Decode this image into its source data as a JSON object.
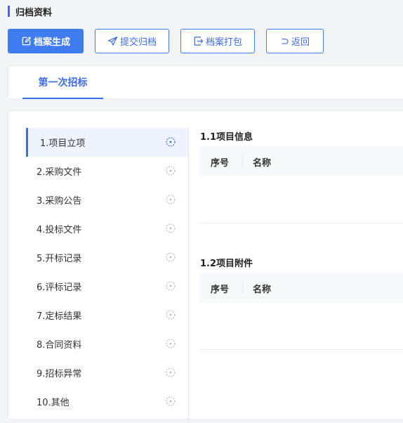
{
  "page": {
    "title": "归档资料"
  },
  "toolbar": {
    "generate_label": "档案生成",
    "submit_label": "提交归档",
    "pack_label": "档案打包",
    "back_label": "返回"
  },
  "tabs": [
    {
      "label": "第一次招标",
      "active": true
    }
  ],
  "nav": {
    "items": [
      {
        "label": "1.项目立项",
        "active": true
      },
      {
        "label": "2.采购文件",
        "active": false
      },
      {
        "label": "3.采购公告",
        "active": false
      },
      {
        "label": "4.投标文件",
        "active": false
      },
      {
        "label": "5.开标记录",
        "active": false
      },
      {
        "label": "6.评标记录",
        "active": false
      },
      {
        "label": "7.定标结果",
        "active": false
      },
      {
        "label": "8.合同资料",
        "active": false
      },
      {
        "label": "9.招标异常",
        "active": false
      },
      {
        "label": "10.其他",
        "active": false
      }
    ],
    "status_icon": "dashed-circle-icon"
  },
  "sections": [
    {
      "title": "1.1项目信息",
      "columns": [
        "序号",
        "名称"
      ],
      "rows": []
    },
    {
      "title": "1.2项目附件",
      "columns": [
        "序号",
        "名称"
      ],
      "rows": []
    }
  ],
  "colors": {
    "accent": "#3f6de8",
    "primary_button": "#3f7cf2",
    "page_background": "#f3f4f7",
    "active_nav_background": "#eef3fe"
  }
}
